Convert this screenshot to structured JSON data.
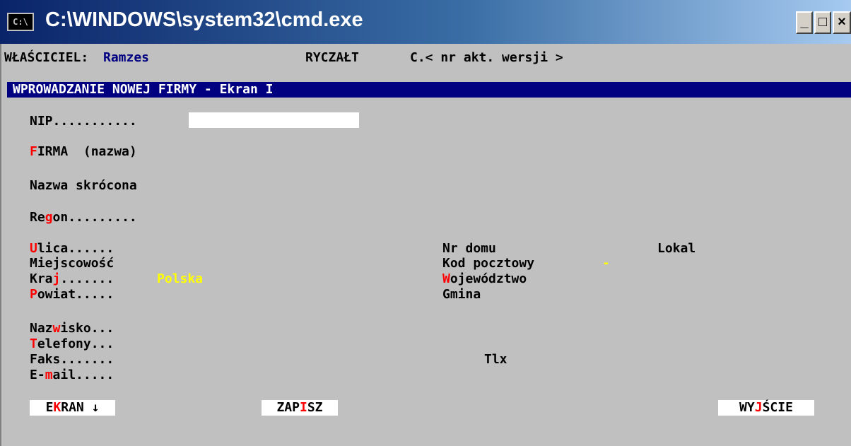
{
  "window": {
    "icon_label": "C:\\",
    "title": "C:\\WINDOWS\\system32\\cmd.exe",
    "minimize_glyph": "_",
    "maximize_glyph": "□",
    "close_glyph": "×"
  },
  "header": {
    "owner_label": "WŁAŚCICIEL:",
    "owner_value": "Ramzes",
    "tax_mode": "RYCZAŁT",
    "version": "C.< nr akt. wersji >"
  },
  "section": {
    "title": "WPROWADZANIE NOWEJ FIRMY - Ekran I"
  },
  "form": {
    "nip_label": "NIP...........",
    "nip_value": "",
    "firma": {
      "pre": "",
      "hot": "F",
      "post": "IRMA  (nazwa)"
    },
    "nazwa_skrocona": "Nazwa skrócona",
    "regon": {
      "pre": "Re",
      "hot": "g",
      "post": "on........."
    },
    "ulica": {
      "pre": "",
      "hot": "U",
      "post": "lica......"
    },
    "miejscowosc": "Miejscowość",
    "kraj": {
      "pre": "Kra",
      "hot": "j",
      "post": "......."
    },
    "kraj_value": "Polska",
    "powiat": {
      "pre": "",
      "hot": "P",
      "post": "owiat....."
    },
    "nr_domu": "Nr domu",
    "lokal": "Lokal",
    "kod_pocztowy": "Kod pocztowy",
    "kod_value": "-",
    "wojewodztwo": {
      "pre": "",
      "hot": "W",
      "post": "ojewództwo"
    },
    "gmina": "Gmina",
    "nazwisko": {
      "pre": "Naz",
      "hot": "w",
      "post": "isko..."
    },
    "telefony": {
      "pre": "",
      "hot": "T",
      "post": "elefony..."
    },
    "faks": "Faks.......",
    "tlx": "Tlx",
    "email": {
      "pre": "E-",
      "hot": "m",
      "post": "ail....."
    }
  },
  "buttons": {
    "ekran": {
      "pre": "E",
      "hot": "K",
      "post": "RAN ↓"
    },
    "zapisz": {
      "pre": "ZAP",
      "hot": "I",
      "post": "SZ"
    },
    "wyjscie": {
      "pre": "WY",
      "hot": "J",
      "post": "ŚCIE"
    }
  },
  "colors": {
    "background": "#c0c0c0",
    "section_bar": "#000080",
    "hotkey": "#ff0000",
    "value_highlight": "#ffff00",
    "owner_value": "#000080"
  }
}
